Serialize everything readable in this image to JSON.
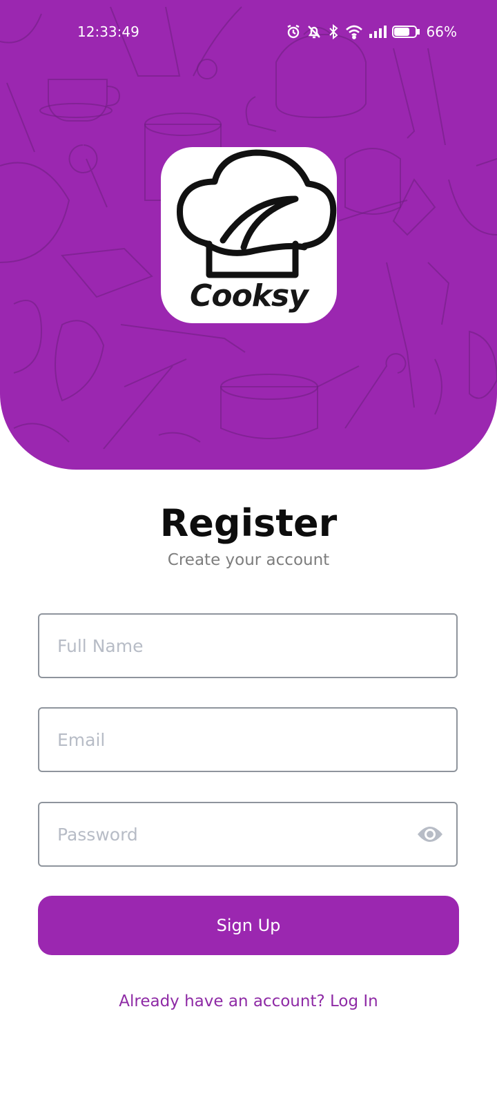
{
  "status_bar": {
    "time": "12:33:49",
    "battery": "66%",
    "icons": [
      "alarm-icon",
      "silent-bell-icon",
      "bluetooth-icon",
      "wifi-icon",
      "signal-icon",
      "battery-icon"
    ]
  },
  "brand": {
    "logo_text": "Cooksy",
    "accent_color": "#9b27b0"
  },
  "header": {
    "title": "Register",
    "subtitle": "Create your account"
  },
  "form": {
    "full_name": {
      "placeholder": "Full Name",
      "value": ""
    },
    "email": {
      "placeholder": "Email",
      "value": ""
    },
    "password": {
      "placeholder": "Password",
      "value": "",
      "toggle_icon": "eye-icon"
    },
    "submit_label": "Sign Up"
  },
  "footer": {
    "login_link": "Already have an account? Log In"
  }
}
